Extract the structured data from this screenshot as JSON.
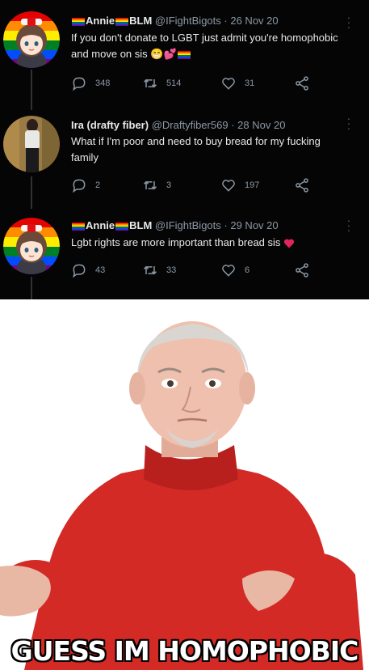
{
  "tweets": [
    {
      "display_name": "Annie",
      "display_name_2": "BLM",
      "handle": "@IFightBigots",
      "date": "26 Nov 20",
      "text": "If you don't donate to LGBT just admit you're homophobic and move on sis",
      "text_emoji": "😁💕",
      "replies": "348",
      "retweets": "514",
      "likes": "31"
    },
    {
      "display_name": "Ira (drafty fiber)",
      "handle": "@Draftyfiber569",
      "date": "28 Nov 20",
      "text": "What if I'm poor and need to buy bread for my fucking family",
      "replies": "2",
      "retweets": "3",
      "likes": "197"
    },
    {
      "display_name": "Annie",
      "display_name_2": "BLM",
      "handle": "@IFightBigots",
      "date": "29 Nov 20",
      "text": "Lgbt rights are more important than bread sis",
      "replies": "43",
      "retweets": "33",
      "likes": "6"
    }
  ],
  "meme": {
    "caption": "GUESS IM HOMOPHOBIC"
  },
  "colors": {
    "background": "#050505",
    "text": "#e7e9ea",
    "muted": "#8b98a5",
    "heart": "#e0245e",
    "sweater": "#d42a26"
  },
  "icons": [
    "reply-icon",
    "retweet-icon",
    "like-icon",
    "share-icon",
    "more-icon",
    "rainbow-flag-icon",
    "heart-emoji-icon"
  ]
}
